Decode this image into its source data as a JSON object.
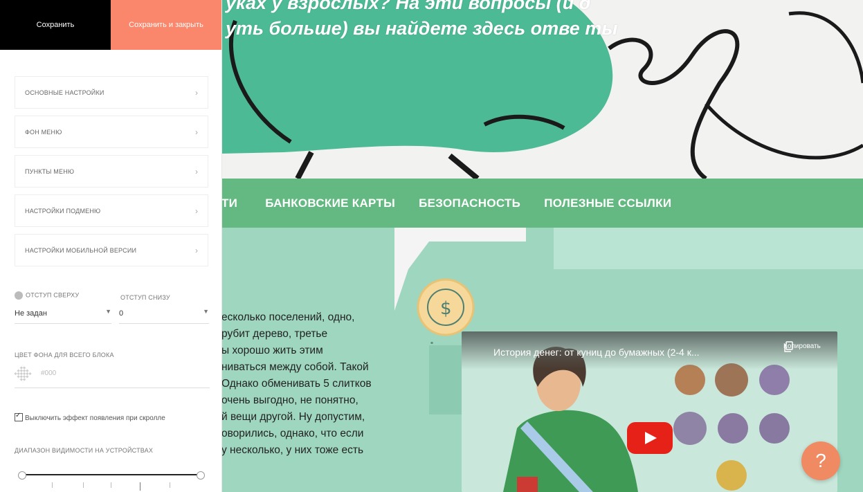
{
  "panel": {
    "save_label": "Сохранить",
    "save_close_label": "Сохранить и закрыть",
    "sections": [
      {
        "label": "Основные настройки"
      },
      {
        "label": "Фон меню"
      },
      {
        "label": "Пункты меню"
      },
      {
        "label": "Настройки подменю"
      },
      {
        "label": "Настройки мобильной версии"
      }
    ],
    "padding_top_label": "Отступ сверху",
    "padding_top_value": "Не задан",
    "padding_bottom_label": "Отступ снизу",
    "padding_bottom_value": "0",
    "bg_color_label": "Цвет фона для всего блока",
    "bg_color_placeholder": "#000",
    "scroll_effect_label": "Выключить эффект появления при скролле",
    "visibility_label": "Диапазон видимости на устройствах"
  },
  "page": {
    "hero_line1": "уках у взрослых? На эти вопросы (и д",
    "hero_line2": "уть больше) вы найдете здесь отве ты",
    "menu": [
      "ТИ",
      "БАНКОВСКИЕ КАРТЫ",
      "БЕЗОПАСНОСТЬ",
      "ПОЛЕЗНЫЕ ССЫЛКИ"
    ],
    "paragraph_lines": [
      "есколько поселений, одно,",
      "рубит дерево, третье",
      "ы хорошо жить этим",
      "ниваться между собой. Такой",
      "Однако обменивать 5 слитков",
      "очень выгодно, не понятно,",
      "й вещи другой. Ну допустим,",
      "оворились, однако, что если",
      "у несколько, у них тоже есть"
    ],
    "video_title": "История денег: от куниц до бумажных (2-4 к...",
    "video_copy_label": "Копировать",
    "help_label": "?"
  },
  "colors": {
    "menu_bg": "#64b982",
    "hero_blob": "#4dba96",
    "save_close_bg": "#fa876b",
    "help_bg": "#f08a63"
  }
}
